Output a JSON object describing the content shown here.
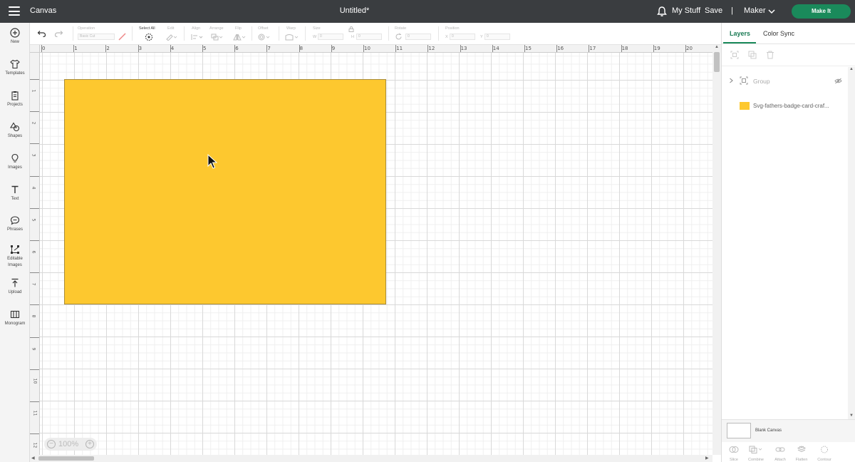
{
  "topbar": {
    "app_title": "Canvas",
    "document_title": "Untitled*",
    "my_stuff": "My Stuff",
    "save": "Save",
    "separator": "|",
    "machine": "Maker",
    "make_it": "Make It"
  },
  "sidebar": {
    "items": [
      {
        "label": "New",
        "icon": "plus-circle-icon"
      },
      {
        "label": "Templates",
        "icon": "shirt-icon"
      },
      {
        "label": "Projects",
        "icon": "clipboard-icon"
      },
      {
        "label": "Shapes",
        "icon": "shapes-icon"
      },
      {
        "label": "Images",
        "icon": "lightbulb-icon"
      },
      {
        "label": "Text",
        "icon": "text-icon"
      },
      {
        "label": "Phrases",
        "icon": "speech-bubble-icon"
      },
      {
        "label": "Editable Images",
        "icon": "vector-edit-icon"
      },
      {
        "label": "Upload",
        "icon": "upload-icon"
      },
      {
        "label": "Monogram",
        "icon": "monogram-icon"
      }
    ]
  },
  "toolbar": {
    "operation_label": "Operation",
    "operation_value": "Basic Cut",
    "select_all_label": "Select All",
    "edit_label": "Edit",
    "align_label": "Align",
    "arrange_label": "Arrange",
    "flip_label": "Flip",
    "offset_label": "Offset",
    "warp_label": "Warp",
    "size_label": "Size",
    "size_w_prefix": "W",
    "size_w_value": "0",
    "size_h_prefix": "H",
    "size_h_value": "0",
    "rotate_label": "Rotate",
    "rotate_value": "0",
    "position_label": "Position",
    "position_x_prefix": "X",
    "position_x_value": "0",
    "position_y_prefix": "Y",
    "position_y_value": "0"
  },
  "ruler": {
    "horizontal": [
      "0",
      "1",
      "2",
      "3",
      "4",
      "5",
      "6",
      "7",
      "8",
      "9",
      "10",
      "11",
      "12",
      "13",
      "14",
      "15",
      "16",
      "17",
      "18",
      "19",
      "20"
    ],
    "vertical": [
      "1",
      "2",
      "3",
      "4",
      "5",
      "6",
      "7",
      "8",
      "9",
      "10",
      "11",
      "12"
    ]
  },
  "canvas": {
    "zoom_out": "−",
    "zoom_level": "100%",
    "zoom_in": "+",
    "shape_color": "#fdc82f"
  },
  "panel": {
    "tab_layers": "Layers",
    "tab_color_sync": "Color Sync",
    "group_label": "Group",
    "layer_name": "Svg-fathers-badge-card-craf...",
    "layer_color": "#fdc82f",
    "blank_canvas": "Blank Canvas",
    "bottom_tools": [
      "Slice",
      "Combine",
      "Attach",
      "Flatten",
      "Contour"
    ]
  },
  "colors": {
    "topbar": "#3a3d40",
    "accent": "#1a8a5b",
    "shape_fill": "#fdc82f"
  }
}
